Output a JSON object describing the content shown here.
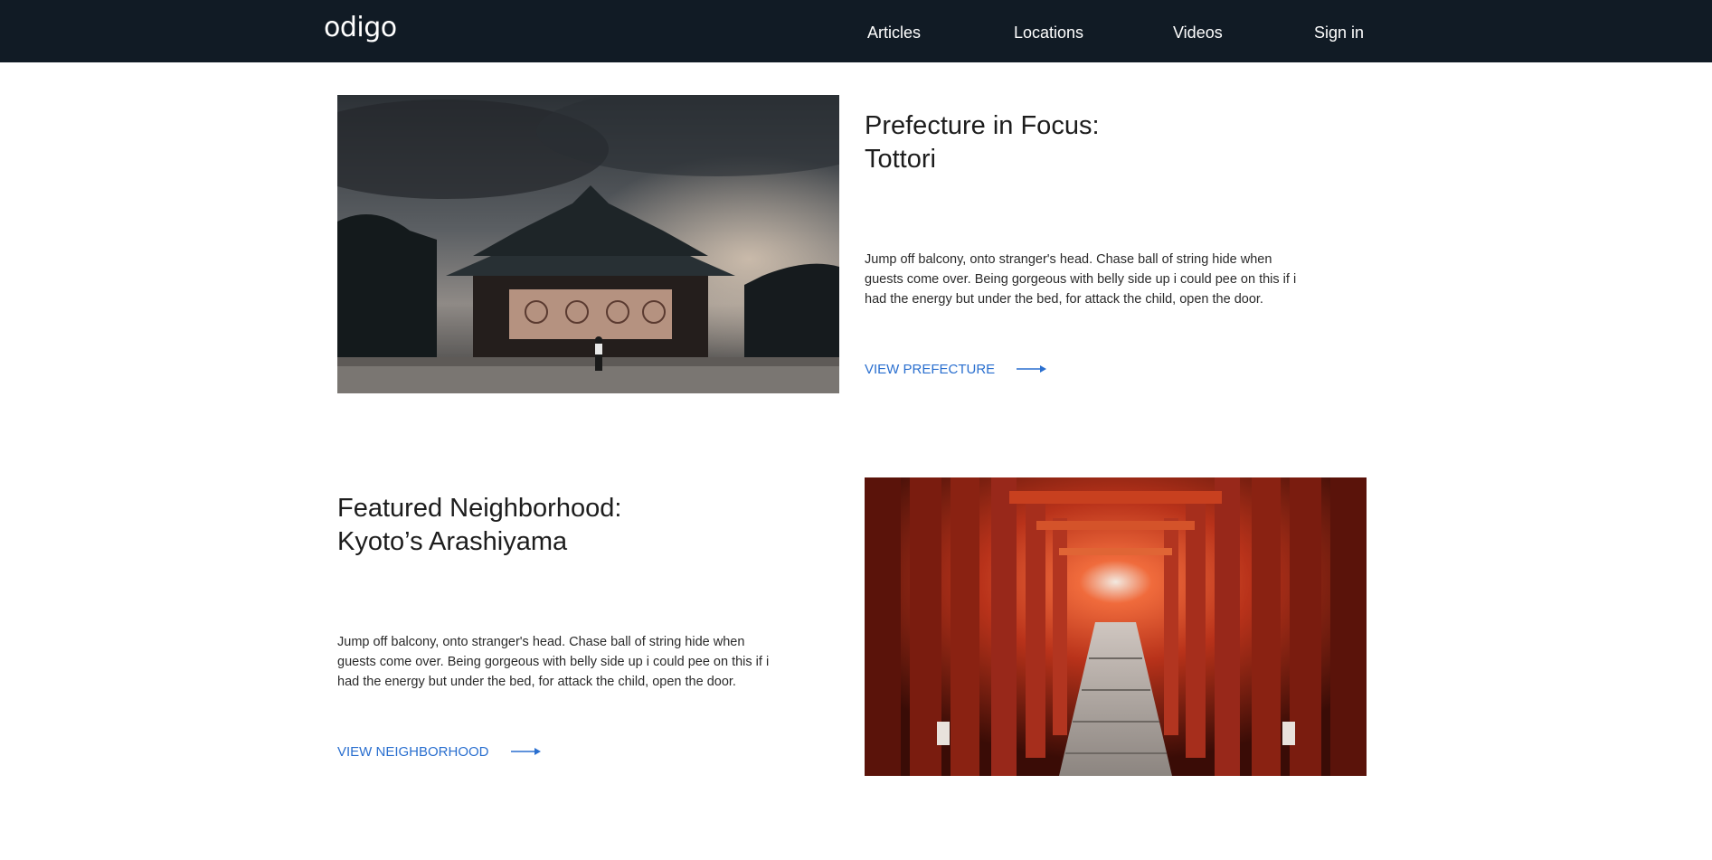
{
  "header": {
    "logo": "odigo",
    "nav": [
      "Articles",
      "Locations",
      "Videos",
      "Sign in"
    ]
  },
  "sections": [
    {
      "title_line1": "Prefecture in Focus:",
      "title_line2": "Tottori",
      "body": "Jump off balcony, onto stranger's head. Chase ball of string hide when guests come over. Being gorgeous with belly side up i could pee on this if i had the energy but under the bed, for attack the child, open the door.",
      "link": "VIEW PREFECTURE"
    },
    {
      "title_line1": "Featured Neighborhood:",
      "title_line2": "Kyoto’s Arashiyama",
      "body": "Jump off balcony, onto stranger's head. Chase ball of string hide when guests come over. Being gorgeous with belly side up i could pee on this if i had the energy but under the bed, for attack the child, open the door.",
      "link": "VIEW NEIGHBORHOOD"
    }
  ],
  "colors": {
    "header_bg": "#111b25",
    "link": "#2a6fcf",
    "text": "#1d1d1d"
  },
  "icons": [
    "arrow-right-icon"
  ]
}
